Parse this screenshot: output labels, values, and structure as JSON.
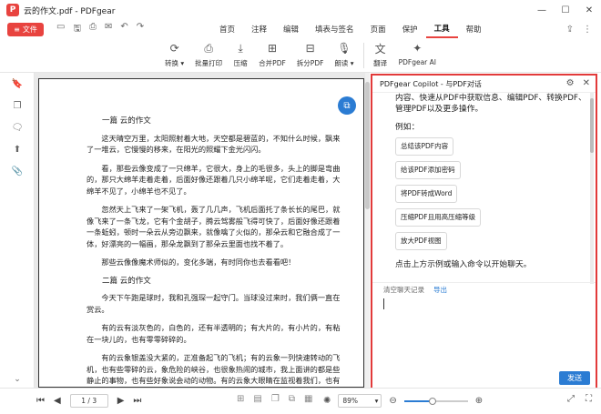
{
  "window": {
    "title": "云的作文.pdf - PDFgear",
    "logo_glyph": "P",
    "controls": {
      "minimize": "—",
      "maximize": "☐",
      "close": "✕"
    }
  },
  "menubar": {
    "file_label": "文件",
    "file_icon": "≡",
    "quick": {
      "open": "▭",
      "save": "🖫",
      "print": "⎙",
      "email": "✉",
      "undo": "↶",
      "redo": "↷"
    },
    "tabs": [
      "首页",
      "注释",
      "编辑",
      "填表与签名",
      "页面",
      "保护",
      "工具",
      "帮助"
    ],
    "active_tab": "工具",
    "right": {
      "share": "⇪",
      "more": "⋮"
    }
  },
  "ribbon": {
    "items": [
      {
        "label": "转换 ▾",
        "icon": "⟳"
      },
      {
        "label": "批量打印",
        "icon": "⎙"
      },
      {
        "label": "压缩",
        "icon": "⤓"
      },
      {
        "label": "合并PDF",
        "icon": "⊞"
      },
      {
        "label": "拆分PDF",
        "icon": "⊟"
      },
      {
        "label": "朗读 ▾",
        "icon": "🎙"
      },
      {
        "label": "翻译",
        "icon": "文"
      },
      {
        "label": "PDFgear AI",
        "icon": "✦"
      }
    ]
  },
  "left_sidebar": {
    "icons": [
      "🔖",
      "❐",
      "🗨",
      "⬆",
      "📎"
    ],
    "bottom": "⌄"
  },
  "document": {
    "paragraphs": [
      {
        "kind": "h",
        "text": "一篇 云的作文"
      },
      {
        "kind": "p",
        "text": "这天晴空万里，太阳照射着大地，天空都是碧蓝的，不知什么时候，飘来了一堆云，它慢慢的移来，在阳光的照耀下金光闪闪。"
      },
      {
        "kind": "p",
        "text": "看，那些云像变成了一只绵羊，它很大，身上的毛很多，头上的脚是弯曲的，那只大绵羊走着走着，后面好像还跟着几只小绵羊呢，它们走着走着，大绵羊不见了，小绵羊也不见了。"
      },
      {
        "kind": "p",
        "text": "忽然天上飞来了一架飞机，轰了几几声，飞机后面托了条长长的尾巴，就像飞来了一条飞龙，它有个金胡子，腾云驾雾般飞得可快了，后面好像还跟着一条蚯蚓，顿时一朵云从旁边飘来，就像噙了火似的，那朵云和它融合成了一体，好漂亮的一幅画，那朵龙飘到了那朵云里面也找不着了。"
      },
      {
        "kind": "p",
        "text": "那些云像像魔术师似的，变化多端，有时同你也去看看吧！"
      },
      {
        "kind": "h",
        "text": "二篇 云的作文"
      },
      {
        "kind": "p",
        "text": "今天下午跑是球时，我和孔强琛一起守门。当球没过来时，我们俩一直在赏云。"
      },
      {
        "kind": "p",
        "text": "有的云有淡灰色的，白色的，还有半透明的；有大片的，有小片的，有粘在一块儿的，也有零零碎碎的。"
      },
      {
        "kind": "p",
        "text": "有的云象银盖没大紧的，正准备起飞的飞机；有的云象一列快速转动的飞机，也有些零碎的云，象危险的峡谷，也很象热闹的城市，我上面讲的都是些静止的事物，也有些好象说会动的动物。有的云象大眼睛在监视着我们，也有象一只只巨鸟，正要向我们俯冲过来，有的云像一个巫婆"
      }
    ],
    "float_icon": "⧉"
  },
  "copilot": {
    "title": "PDFgear Copilot - 与PDF对话",
    "header_icons": {
      "settings": "⚙",
      "close": "✕"
    },
    "intro": "内容、快速从PDF中获取信息、编辑PDF、转换PDF、管理PDF以及更多操作。",
    "example_label": "例如：",
    "chips": [
      "总结该PDF内容",
      "给该PDF添加密码",
      "将PDF转成Word",
      "压缩PDF且用高压缩等级",
      "放大PDF视图"
    ],
    "hint": "点击上方示例或输入命令以开始聊天。",
    "clear_label": "清空聊天记录",
    "export_label": "导出",
    "send_label": "发送"
  },
  "statusbar": {
    "nav": {
      "first": "⏮",
      "prev": "◀",
      "next": "▶",
      "last": "⏭"
    },
    "page_value": "1 / 3",
    "tools": [
      "⊞",
      "▤",
      "❐",
      "⧉",
      "▦"
    ],
    "zoom_value": "89%",
    "zoom_fraction": 0.45,
    "right_icons": {
      "brightness": "✺",
      "zoom_out": "⊖",
      "zoom_in": "⊕",
      "fit": "⤢",
      "fullscreen": "⛶"
    }
  }
}
